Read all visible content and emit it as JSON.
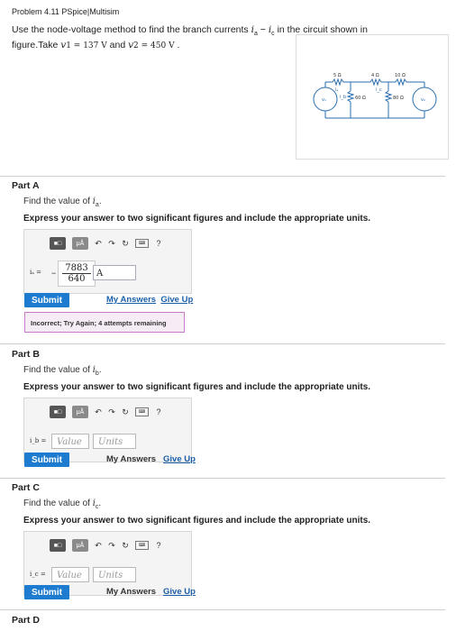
{
  "header": {
    "title": "Problem 4.11 PSpice|Multisim"
  },
  "problem": {
    "line1_prefix": "Use the node-voltage method to find the branch currents ",
    "ia": "i",
    "ia_sub": "a",
    "dash": " − ",
    "ic": "i",
    "ic_sub": "c",
    "line1_suffix": " in the circuit shown in",
    "line2_prefix": "figure.Take ",
    "v1": "v",
    "v1_eq": "1 = 137 V",
    "and": " and ",
    "v2": "v",
    "v2_eq": "2 = 450 V",
    "end": " ."
  },
  "figure": {
    "r1": "5 Ω",
    "r2": "4 Ω",
    "r3": "10 Ω",
    "r4": "60 Ω",
    "r5": "80 Ω",
    "v1": "v₁",
    "v2": "v₂",
    "ia": "iₐ",
    "ib": "i_b",
    "ic": "i_c"
  },
  "toolbar": {
    "btn1": "■□",
    "btn2": "μÅ",
    "undo": "↶",
    "redo": "↷",
    "reset": "↻",
    "keyboard": "⌨",
    "help": "?"
  },
  "parts": [
    {
      "title": "Part A",
      "find_prefix": "Find the value of ",
      "var": "i",
      "var_sub": "a",
      "find_suffix": ".",
      "express": "Express your answer to two significant figures and include the appropriate units.",
      "var_label": "iₐ =",
      "sign": "−",
      "numerator": "7883",
      "denominator": "640",
      "unit_value": "A",
      "submit": "Submit",
      "my_answers": "My Answers",
      "give_up": "Give Up",
      "feedback": "Incorrect; Try Again; 4 attempts remaining"
    },
    {
      "title": "Part B",
      "find_prefix": "Find the value of ",
      "var": "i",
      "var_sub": "b",
      "find_suffix": ".",
      "express": "Express your answer to two significant figures and include the appropriate units.",
      "var_label": "i_b =",
      "value_placeholder": "Value",
      "units_placeholder": "Units",
      "submit": "Submit",
      "my_answers": "My Answers",
      "give_up": "Give Up"
    },
    {
      "title": "Part C",
      "find_prefix": "Find the value of ",
      "var": "i",
      "var_sub": "c",
      "find_suffix": ".",
      "express": "Express your answer to two significant figures and include the appropriate units.",
      "var_label": "i_c =",
      "value_placeholder": "Value",
      "units_placeholder": "Units",
      "submit": "Submit",
      "my_answers": "My Answers",
      "give_up": "Give Up"
    },
    {
      "title": "Part D"
    }
  ]
}
